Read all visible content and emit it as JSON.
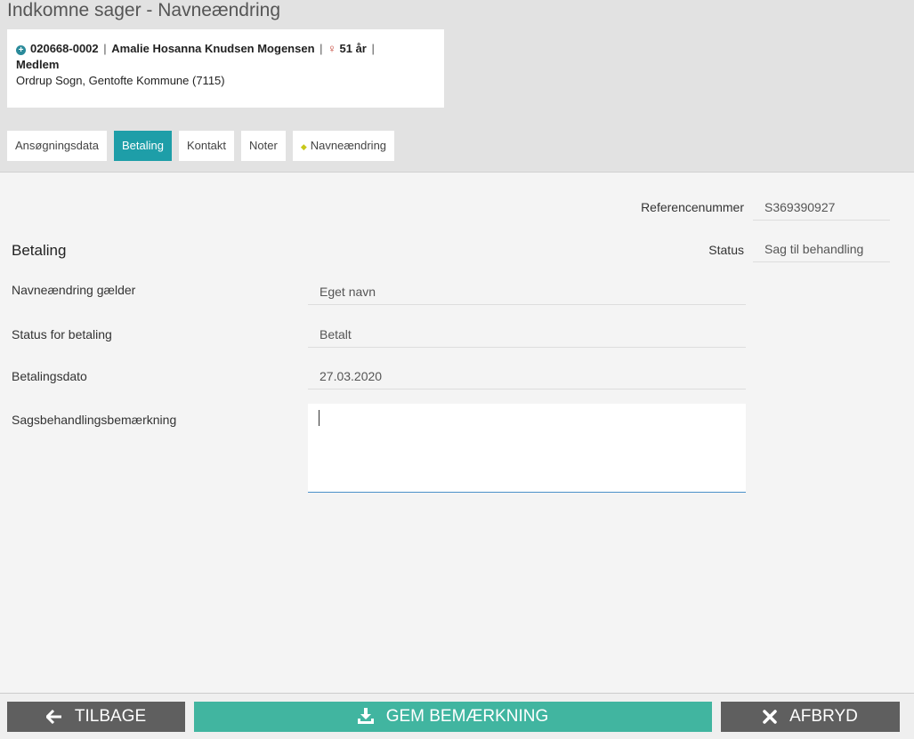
{
  "page": {
    "title": "Indkomne sager - Navneændring"
  },
  "person": {
    "id": "020668-0002",
    "name": "Amalie Hosanna Knudsen Mogensen",
    "age": "51 år",
    "membership": "Medlem",
    "location": "Ordrup Sogn, Gentofte Kommune (7115)",
    "gender_icon": "female-icon"
  },
  "tabs": [
    {
      "label": "Ansøgningsdata"
    },
    {
      "label": "Betaling"
    },
    {
      "label": "Kontakt"
    },
    {
      "label": "Noter"
    },
    {
      "label": "Navneændring"
    }
  ],
  "meta": {
    "reference_label": "Referencenummer",
    "reference_value": "S369390927",
    "status_label": "Status",
    "status_value": "Sag til behandling"
  },
  "section": {
    "title": "Betaling",
    "rows": [
      {
        "label": "Navneændring gælder",
        "value": "Eget navn"
      },
      {
        "label": "Status for betaling",
        "value": "Betalt"
      },
      {
        "label": "Betalingsdato",
        "value": "27.03.2020"
      }
    ],
    "remark_label": "Sagsbehandlingsbemærkning",
    "remark_value": ""
  },
  "footer": {
    "back_label": "TILBAGE",
    "save_label": "GEM BEMÆRKNING",
    "cancel_label": "AFBRYD"
  },
  "colors": {
    "accent": "#1e9ea8",
    "save_button": "#41b5a0",
    "dark_button": "#5f5f5f"
  }
}
